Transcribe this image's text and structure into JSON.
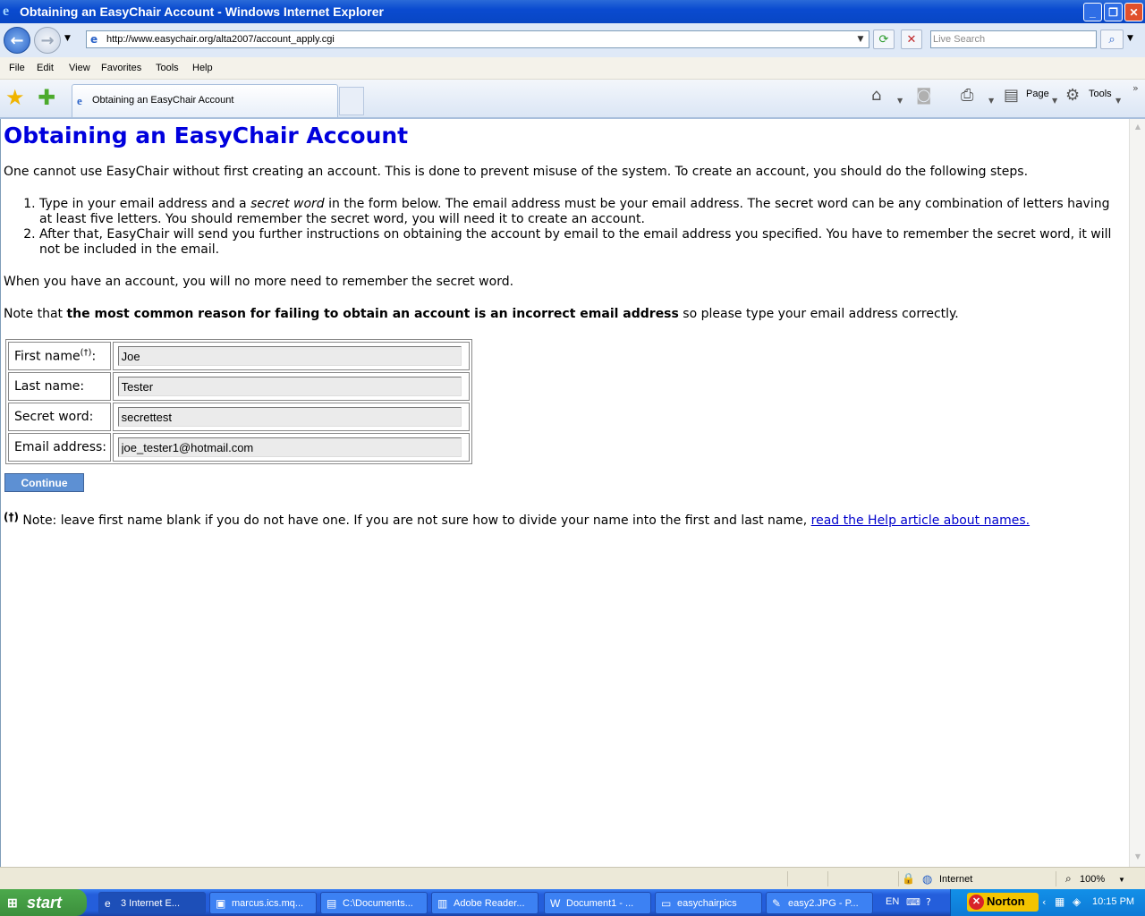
{
  "window": {
    "title": "Obtaining an EasyChair Account - Windows Internet Explorer"
  },
  "browser": {
    "url": "http://www.easychair.org/alta2007/account_apply.cgi",
    "search_placeholder": "Live Search",
    "menu": [
      "File",
      "Edit",
      "View",
      "Favorites",
      "Tools",
      "Help"
    ],
    "tab_title": "Obtaining an EasyChair Account",
    "toolbar": {
      "page": "Page",
      "tools": "Tools"
    }
  },
  "page": {
    "heading": "Obtaining an EasyChair Account",
    "intro": "One cannot use EasyChair without first creating an account. This is done to prevent misuse of the system. To create an account, you should do the following steps.",
    "step1_before": "Type in your email address and a ",
    "step1_em": "secret word",
    "step1_after": " in the form below. The email address must be your email address. The secret word can be any combination of letters having at least five letters. You should remember the secret word, you will need it to create an account.",
    "step2": "After that, EasyChair will send you further instructions on obtaining the account by email to the email address you specified. You have to remember the secret word, it will not be included in the email.",
    "account_note": "When you have an account, you will no more need to remember the secret word.",
    "warning_before": "Note that ",
    "warning_bold": "the most common reason for failing to obtain an account is an incorrect email address",
    "warning_after": " so please type your email address correctly.",
    "form": {
      "first_name_label": "First name",
      "dagger": "(†)",
      "colon": ":",
      "first_name_value": "Joe",
      "last_name_label": "Last name:",
      "last_name_value": "Tester",
      "secret_label": "Secret word:",
      "secret_value": "secrettest",
      "email_label": "Email address:",
      "email_value": "joe_tester1@hotmail.com"
    },
    "continue_label": "Continue",
    "footnote_mark": "(†)",
    "footnote_text": " Note: leave first name blank if you do not have one. If you are not sure how to divide your name into the first and last name, ",
    "footnote_link": "read the Help article about names."
  },
  "status_bar": {
    "zone": "Internet",
    "zoom": "100%"
  },
  "taskbar": {
    "start": "start",
    "tasks": [
      "3 Internet E...",
      "marcus.ics.mq...",
      "C:\\Documents...",
      "Adobe Reader...",
      "Document1 - ...",
      "easychairpics",
      "easy2.JPG - P..."
    ],
    "lang": "EN",
    "norton": "Norton",
    "clock": "10:15 PM"
  }
}
